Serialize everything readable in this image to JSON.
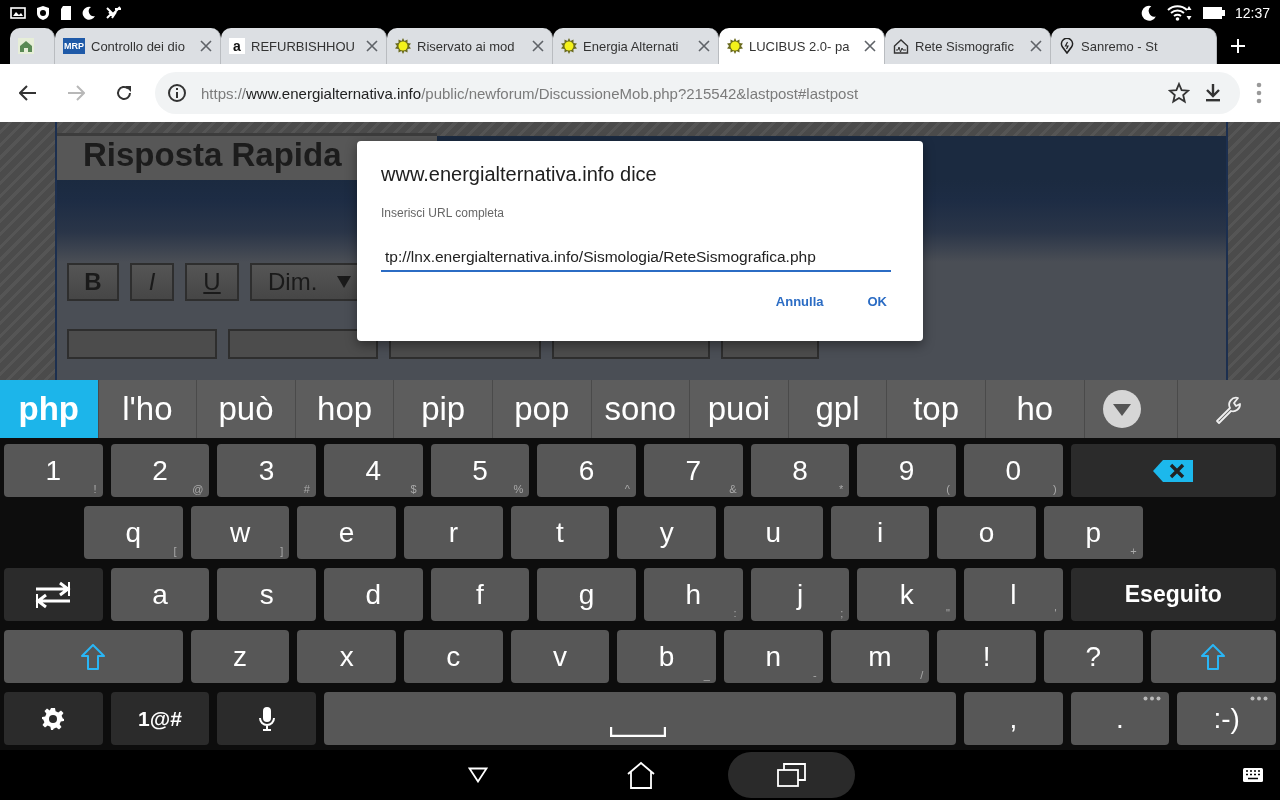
{
  "status_bar": {
    "time": "12:37"
  },
  "tabs": [
    {
      "icon": {
        "kind": "house"
      },
      "selected": false,
      "closable": false
    },
    {
      "title": "Controllo dei dio",
      "icon": {
        "kind": "badge",
        "text": "MRP"
      },
      "selected": false,
      "closable": true
    },
    {
      "title": "REFURBISHHOU",
      "icon": {
        "kind": "letter",
        "text": "a"
      },
      "selected": false,
      "closable": true
    },
    {
      "title": "Riservato ai mod",
      "icon": {
        "kind": "sun"
      },
      "selected": false,
      "closable": true
    },
    {
      "title": "Energia Alternati",
      "icon": {
        "kind": "sun"
      },
      "selected": false,
      "closable": true
    },
    {
      "title": "LUCIBUS 2.0- pa",
      "icon": {
        "kind": "sun"
      },
      "selected": true,
      "closable": true
    },
    {
      "title": "Rete Sismografic",
      "icon": {
        "kind": "seismo"
      },
      "selected": false,
      "closable": true
    },
    {
      "title": "Sanremo - St",
      "icon": {
        "kind": "pin"
      },
      "selected": false,
      "closable": false
    }
  ],
  "toolbar": {
    "forward_disabled": true,
    "url": [
      {
        "text": "https://",
        "kind": "dim"
      },
      {
        "text": "www.energialternativa.info",
        "kind": "host"
      },
      {
        "text": "/public/newforum/DiscussioneMob.php?215542&lastpost#lastpost",
        "kind": "dim"
      }
    ]
  },
  "page": {
    "heading": "Risposta Rapida",
    "format_buttons": [
      {
        "label": "B",
        "kind": "bold"
      },
      {
        "label": "I",
        "kind": "italic"
      },
      {
        "label": "U",
        "kind": "underline"
      },
      {
        "label": "Dim.",
        "kind": "dropdown"
      }
    ]
  },
  "dialog": {
    "title": "www.energialternativa.info dice",
    "label": "Inserisci URL completa",
    "value": "tp://lnx.energialternativa.info/Sismologia/ReteSismografica.php",
    "buttons": [
      "Annulla",
      "OK"
    ]
  },
  "suggestions": [
    {
      "text": "php",
      "selected": true
    },
    {
      "text": "l'ho",
      "selected": false
    },
    {
      "text": "può",
      "selected": false
    },
    {
      "text": "hop",
      "selected": false
    },
    {
      "text": "pip",
      "selected": false
    },
    {
      "text": "pop",
      "selected": false
    },
    {
      "text": "sono",
      "selected": false
    },
    {
      "text": "puoi",
      "selected": false
    },
    {
      "text": "gpl",
      "selected": false
    },
    {
      "text": "top",
      "selected": false
    },
    {
      "text": "ho",
      "selected": false
    }
  ],
  "keyboard": [
    [
      {
        "kind": "char",
        "label": "1",
        "hint": "!"
      },
      {
        "kind": "char",
        "label": "2",
        "hint": "@"
      },
      {
        "kind": "char",
        "label": "3",
        "hint": "#"
      },
      {
        "kind": "char",
        "label": "4",
        "hint": "$"
      },
      {
        "kind": "char",
        "label": "5",
        "hint": "%"
      },
      {
        "kind": "char",
        "label": "6",
        "hint": "^"
      },
      {
        "kind": "char",
        "label": "7",
        "hint": "&"
      },
      {
        "kind": "char",
        "label": "8",
        "hint": "*"
      },
      {
        "kind": "char",
        "label": "9",
        "hint": "("
      },
      {
        "kind": "char",
        "label": "0",
        "hint": ")"
      },
      {
        "kind": "backspace"
      }
    ],
    [
      {
        "kind": "char",
        "label": "q",
        "hint": "["
      },
      {
        "kind": "char",
        "label": "w",
        "hint": "]"
      },
      {
        "kind": "char",
        "label": "e"
      },
      {
        "kind": "char",
        "label": "r"
      },
      {
        "kind": "char",
        "label": "t"
      },
      {
        "kind": "char",
        "label": "y"
      },
      {
        "kind": "char",
        "label": "u"
      },
      {
        "kind": "char",
        "label": "i"
      },
      {
        "kind": "char",
        "label": "o"
      },
      {
        "kind": "char",
        "label": "p",
        "hint": "+"
      }
    ],
    [
      {
        "kind": "switch"
      },
      {
        "kind": "char",
        "label": "a"
      },
      {
        "kind": "char",
        "label": "s"
      },
      {
        "kind": "char",
        "label": "d"
      },
      {
        "kind": "char",
        "label": "f"
      },
      {
        "kind": "char",
        "label": "g"
      },
      {
        "kind": "char",
        "label": "h",
        "hint": ":"
      },
      {
        "kind": "char",
        "label": "j",
        "hint": ";"
      },
      {
        "kind": "char",
        "label": "k",
        "hint": "\""
      },
      {
        "kind": "char",
        "label": "l",
        "hint": "'"
      },
      {
        "kind": "enter",
        "label": "Eseguito"
      }
    ],
    [
      {
        "kind": "shift"
      },
      {
        "kind": "char",
        "label": "z"
      },
      {
        "kind": "char",
        "label": "x"
      },
      {
        "kind": "char",
        "label": "c"
      },
      {
        "kind": "char",
        "label": "v"
      },
      {
        "kind": "char",
        "label": "b",
        "hint": "_"
      },
      {
        "kind": "char",
        "label": "n",
        "hint": "-"
      },
      {
        "kind": "char",
        "label": "m",
        "hint": "/"
      },
      {
        "kind": "char",
        "label": "!"
      },
      {
        "kind": "char",
        "label": "?"
      },
      {
        "kind": "shift"
      }
    ],
    [
      {
        "kind": "settings",
        "popup": false
      },
      {
        "kind": "symbols",
        "label": "1@#",
        "popup": false
      },
      {
        "kind": "mic",
        "popup": false
      },
      {
        "kind": "space",
        "popup": false
      },
      {
        "kind": "char",
        "label": ",",
        "popup": false
      },
      {
        "kind": "char",
        "label": ".",
        "popup": true
      },
      {
        "kind": "char",
        "label": ":-)",
        "popup": true
      }
    ]
  ]
}
